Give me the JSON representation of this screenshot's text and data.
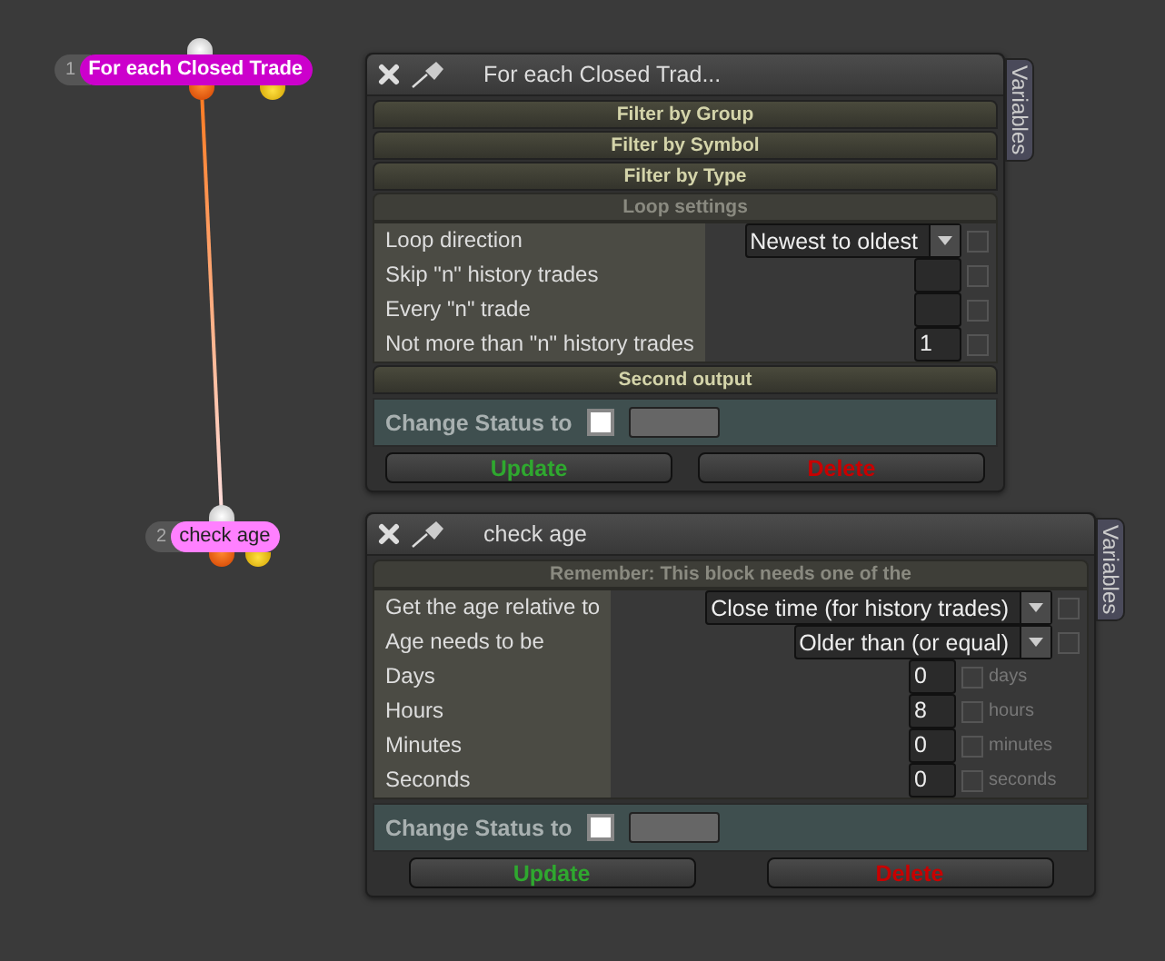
{
  "nodes": [
    {
      "number": "1",
      "label": "For each Closed Trade",
      "color": "#cc00cc"
    },
    {
      "number": "2",
      "label": "check age",
      "color": "#ff80ff"
    }
  ],
  "panels": [
    {
      "title": "For each Closed Trad...",
      "side_tab": "Variables",
      "items": [
        {
          "kind": "section",
          "label": "Filter by Group"
        },
        {
          "kind": "section",
          "label": "Filter by Symbol"
        },
        {
          "kind": "section",
          "label": "Filter by Type"
        },
        {
          "kind": "header",
          "label": "Loop settings"
        },
        {
          "kind": "dropdown",
          "label": "Loop direction",
          "value": "Newest to oldest",
          "checked": false
        },
        {
          "kind": "number",
          "label": "Skip \"n\" history trades",
          "value": "",
          "checked": false
        },
        {
          "kind": "number",
          "label": "Every \"n\" trade",
          "value": "",
          "checked": false
        },
        {
          "kind": "number",
          "label": "Not more than \"n\" history trades",
          "value": "1",
          "checked": false
        },
        {
          "kind": "section",
          "label": "Second output"
        }
      ],
      "status_label": "Change Status to",
      "status_checked": false,
      "buttons": [
        {
          "kind": "update",
          "label": "Update"
        },
        {
          "kind": "delete",
          "label": "Delete"
        }
      ]
    },
    {
      "title": "check age",
      "side_tab": "Variables",
      "items": [
        {
          "kind": "header",
          "label": "Remember: This block needs one of the"
        },
        {
          "kind": "dropdown",
          "label": "Get the age relative to",
          "value": "Close time (for history trades)",
          "checked": false
        },
        {
          "kind": "dropdown",
          "label": "Age needs to be",
          "value": "Older than (or equal)",
          "checked": false
        },
        {
          "kind": "number",
          "label": "Days",
          "value": "0",
          "checked": false,
          "unit": "days"
        },
        {
          "kind": "number",
          "label": "Hours",
          "value": "8",
          "checked": false,
          "unit": "hours"
        },
        {
          "kind": "number",
          "label": "Minutes",
          "value": "0",
          "checked": false,
          "unit": "minutes"
        },
        {
          "kind": "number",
          "label": "Seconds",
          "value": "0",
          "checked": false,
          "unit": "seconds"
        }
      ],
      "status_label": "Change Status to",
      "status_checked": false,
      "buttons": [
        {
          "kind": "update",
          "label": "Update"
        },
        {
          "kind": "delete",
          "label": "Delete"
        }
      ]
    }
  ]
}
